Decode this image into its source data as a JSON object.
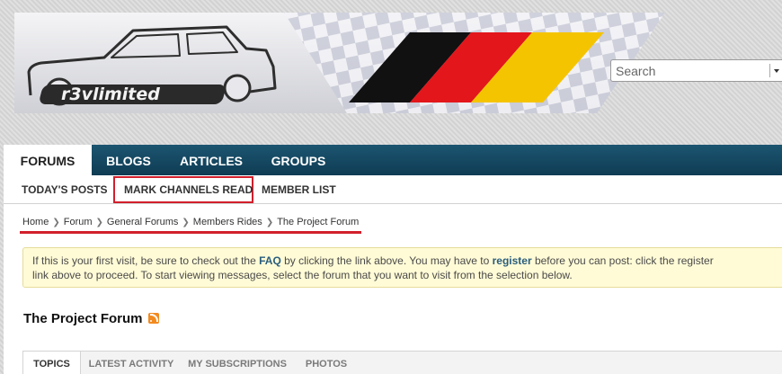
{
  "header": {
    "logo_text": "r3vlimited",
    "search": {
      "placeholder": "Search",
      "value": ""
    }
  },
  "navbar": {
    "tabs": [
      {
        "label": "FORUMS",
        "active": true
      },
      {
        "label": "BLOGS",
        "active": false
      },
      {
        "label": "ARTICLES",
        "active": false
      },
      {
        "label": "GROUPS",
        "active": false
      }
    ]
  },
  "subnav": {
    "links": [
      {
        "label": "TODAY'S POSTS"
      },
      {
        "label": "MARK CHANNELS READ",
        "highlighted": true
      },
      {
        "label": "MEMBER LIST"
      }
    ]
  },
  "breadcrumb": [
    "Home",
    "Forum",
    "General Forums",
    "Members Rides",
    "The Project Forum"
  ],
  "notice": {
    "line1_before_faq": "If this is your first visit, be sure to check out the ",
    "faq_link": "FAQ",
    "line1_after_faq": " by clicking the link above. You may have to ",
    "register_link": "register",
    "line1_end": " before you can post: click the register",
    "line2": "link above to proceed. To start viewing messages, select the forum that you want to visit from the selection below."
  },
  "page": {
    "title": "The Project Forum"
  },
  "content_tabs": [
    {
      "label": "TOPICS",
      "active": true
    },
    {
      "label": "LATEST ACTIVITY",
      "active": false
    },
    {
      "label": "MY SUBSCRIPTIONS",
      "active": false
    },
    {
      "label": "PHOTOS",
      "active": false
    }
  ],
  "colors": {
    "nav_bg": "#0f3c54",
    "highlight_red": "#d21f2c",
    "notice_bg": "#fffbd6",
    "link_blue": "#2a5d7d",
    "rss_orange": "#f28a1f",
    "flag_black": "#111111",
    "flag_red": "#e3161b",
    "flag_gold": "#f5c400"
  }
}
